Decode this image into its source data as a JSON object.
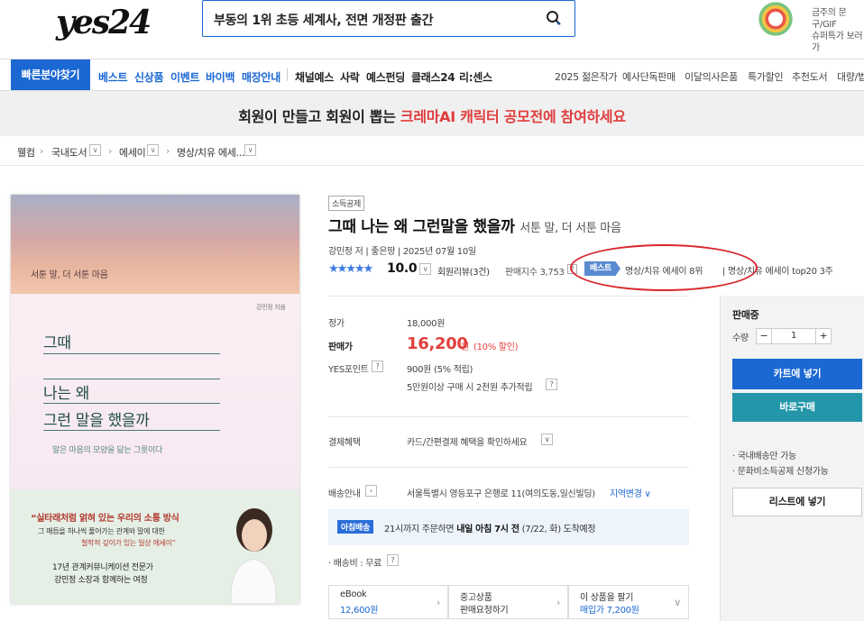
{
  "header": {
    "logo": "yes24",
    "search_query": "부동의 1위 초등 세계사, 전면 개정판 출간",
    "promo_line1": "금주의 문구/GIF",
    "promo_line2": "슈퍼특가 보러가"
  },
  "nav": {
    "quick": "빠른분야찾기",
    "blue_items": [
      "베스트",
      "신상품",
      "이벤트",
      "바이백",
      "매장안내"
    ],
    "dark_items": [
      "채널예스",
      "사락",
      "예스펀딩",
      "클래스24",
      "리:센스"
    ],
    "right_items": [
      "2025 젊은작가",
      "예사단독판매",
      "이달의사은품",
      "특가할인",
      "추천도서",
      "대량/법"
    ]
  },
  "banner": {
    "text_prefix": "회원이 만들고 회원이 뽑는 ",
    "text_highlight": "크레마AI 캐릭터 공모전에 참여하세요"
  },
  "breadcrumb": [
    "웰컴",
    "국내도서",
    "에세이",
    "명상/치유 에세..."
  ],
  "cover": {
    "subtitle": "서툰 말, 더 서툰 마음",
    "author": "강민정 지음",
    "title_line1": "그때",
    "title_line2": "나는      왜",
    "title_line3": "그런 말을 했을까",
    "tagline": "말은 마음의 모양을 닮는 그릇이다",
    "quote1": "“실타래처럼 얽혀 있는 우리의 소통 방식",
    "quote2": "그 매듭을 하나씩 풀어가는 관계와 말에 대한",
    "quote3": "철학적 깊이가 있는 일상 에세이”",
    "quote4": "17년 관계커뮤니케이션 전문가",
    "quote5": "강민정 소장과 함께하는 여정"
  },
  "product": {
    "tag": "소득공제",
    "title": "그때 나는 왜 그런말을 했을까",
    "subtitle": "서툰 말, 더 서툰 마음",
    "meta": "강민정 저  |  좋은땅  |  2025년 07월 10일",
    "stars": "★★★★★",
    "rating": "10.0",
    "review": "회원리뷰(3건)",
    "sales_index": "판매지수 3,753",
    "best_badge": "베스트",
    "best_rank1": "명상/치유 에세이 8위",
    "best_rank2": "|  명상/치유 에세이 top20 3주"
  },
  "price": {
    "list_label": "정가",
    "list_value": "18,000원",
    "sale_label": "판매가",
    "sale_value": "16,200",
    "sale_unit": "원",
    "discount": "(10% 할인)",
    "point_label": "YES포인트",
    "point_value": "900원 (5% 적립)",
    "point_extra": "5만원이상 구매 시 2천원 추가적립"
  },
  "payment": {
    "label": "결제혜택",
    "value": "카드/간편결제 혜택을 확인하세요"
  },
  "shipping": {
    "label": "배송안내",
    "address": "서울특별시 영등포구 은행로 11(여의도동,일신빌딩)",
    "change": "지역변경",
    "morning_badge": "아침배송",
    "morning_prefix": "21시까지 주문하면 ",
    "morning_bold": "내일 아침 7시 전",
    "morning_suffix": " (7/22, 화) 도착예정",
    "fee": "· 배송비 : 무료"
  },
  "tiles": [
    {
      "line1": "eBook",
      "line2": "12,600원"
    },
    {
      "line1": "중고상품",
      "line2": "판매요청하기"
    },
    {
      "line1": "이 상품을 팔기",
      "line2": "매입가 7,200원"
    }
  ],
  "side": {
    "status": "판매중",
    "qty_label": "수량",
    "qty_value": "1",
    "cart": "카트에 넣기",
    "buy": "바로구매",
    "note1": "· 국내배송만 가능",
    "note2": "· 문화비소득공제 신청가능",
    "list": "리스트에 넣기"
  },
  "colors": {
    "accent": "#1b68d3",
    "sale": "#e0403c",
    "buy": "#2396a9",
    "highlight_oval": "#d8262d"
  }
}
